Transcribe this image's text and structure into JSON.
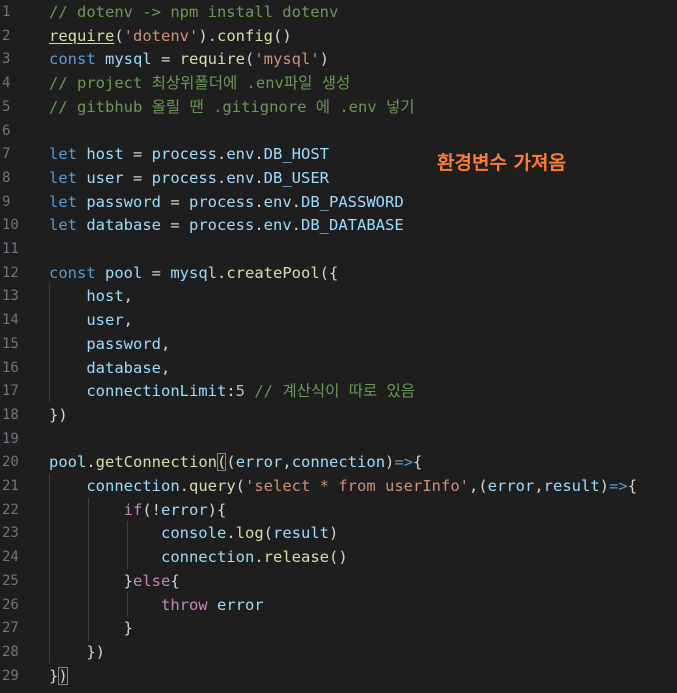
{
  "editor": {
    "lines": [
      {
        "n": "1",
        "tokens": [
          {
            "t": "// dotenv -> npm install dotenv",
            "c": "cm"
          }
        ]
      },
      {
        "n": "2",
        "tokens": [
          {
            "t": "require",
            "c": "fn ul"
          },
          {
            "t": "(",
            "c": "pun"
          },
          {
            "t": "'dotenv'",
            "c": "str"
          },
          {
            "t": ").",
            "c": "pun"
          },
          {
            "t": "config",
            "c": "fn"
          },
          {
            "t": "()",
            "c": "pun"
          }
        ]
      },
      {
        "n": "3",
        "tokens": [
          {
            "t": "const ",
            "c": "kw"
          },
          {
            "t": "mysql",
            "c": "var"
          },
          {
            "t": " = ",
            "c": "pun"
          },
          {
            "t": "require",
            "c": "fn"
          },
          {
            "t": "(",
            "c": "pun"
          },
          {
            "t": "'mysql'",
            "c": "str"
          },
          {
            "t": ")",
            "c": "pun"
          }
        ]
      },
      {
        "n": "4",
        "tokens": [
          {
            "t": "// project 최상위폴더에 .env파일 생성",
            "c": "cm"
          }
        ]
      },
      {
        "n": "5",
        "tokens": [
          {
            "t": "// gitbhub 올릴 땐 .gitignore 에 .env 넣기",
            "c": "cm"
          }
        ]
      },
      {
        "n": "6",
        "tokens": []
      },
      {
        "n": "7",
        "tokens": [
          {
            "t": "let ",
            "c": "kw"
          },
          {
            "t": "host",
            "c": "var"
          },
          {
            "t": " = ",
            "c": "pun"
          },
          {
            "t": "process",
            "c": "var"
          },
          {
            "t": ".",
            "c": "pun"
          },
          {
            "t": "env",
            "c": "var"
          },
          {
            "t": ".",
            "c": "pun"
          },
          {
            "t": "DB_HOST",
            "c": "var"
          }
        ]
      },
      {
        "n": "8",
        "tokens": [
          {
            "t": "let ",
            "c": "kw"
          },
          {
            "t": "user",
            "c": "var"
          },
          {
            "t": " = ",
            "c": "pun"
          },
          {
            "t": "process",
            "c": "var"
          },
          {
            "t": ".",
            "c": "pun"
          },
          {
            "t": "env",
            "c": "var"
          },
          {
            "t": ".",
            "c": "pun"
          },
          {
            "t": "DB_USER",
            "c": "var"
          }
        ]
      },
      {
        "n": "9",
        "tokens": [
          {
            "t": "let ",
            "c": "kw"
          },
          {
            "t": "password",
            "c": "var"
          },
          {
            "t": " = ",
            "c": "pun"
          },
          {
            "t": "process",
            "c": "var"
          },
          {
            "t": ".",
            "c": "pun"
          },
          {
            "t": "env",
            "c": "var"
          },
          {
            "t": ".",
            "c": "pun"
          },
          {
            "t": "DB_PASSWORD",
            "c": "var"
          }
        ]
      },
      {
        "n": "10",
        "tokens": [
          {
            "t": "let ",
            "c": "kw"
          },
          {
            "t": "database",
            "c": "var"
          },
          {
            "t": " = ",
            "c": "pun"
          },
          {
            "t": "process",
            "c": "var"
          },
          {
            "t": ".",
            "c": "pun"
          },
          {
            "t": "env",
            "c": "var"
          },
          {
            "t": ".",
            "c": "pun"
          },
          {
            "t": "DB_DATABASE",
            "c": "var"
          }
        ]
      },
      {
        "n": "11",
        "tokens": []
      },
      {
        "n": "12",
        "tokens": [
          {
            "t": "const ",
            "c": "kw"
          },
          {
            "t": "pool",
            "c": "var"
          },
          {
            "t": " = ",
            "c": "pun"
          },
          {
            "t": "mysql",
            "c": "var"
          },
          {
            "t": ".",
            "c": "pun"
          },
          {
            "t": "createPool",
            "c": "fn"
          },
          {
            "t": "({",
            "c": "pun"
          }
        ]
      },
      {
        "n": "13",
        "tokens": [
          {
            "t": "    ",
            "c": "pun"
          },
          {
            "t": "host",
            "c": "var"
          },
          {
            "t": ",",
            "c": "pun"
          }
        ]
      },
      {
        "n": "14",
        "tokens": [
          {
            "t": "    ",
            "c": "pun"
          },
          {
            "t": "user",
            "c": "var"
          },
          {
            "t": ",",
            "c": "pun"
          }
        ]
      },
      {
        "n": "15",
        "tokens": [
          {
            "t": "    ",
            "c": "pun"
          },
          {
            "t": "password",
            "c": "var"
          },
          {
            "t": ",",
            "c": "pun"
          }
        ]
      },
      {
        "n": "16",
        "tokens": [
          {
            "t": "    ",
            "c": "pun"
          },
          {
            "t": "database",
            "c": "var"
          },
          {
            "t": ",",
            "c": "pun"
          }
        ]
      },
      {
        "n": "17",
        "tokens": [
          {
            "t": "    ",
            "c": "pun"
          },
          {
            "t": "connectionLimit",
            "c": "var"
          },
          {
            "t": ":",
            "c": "pun"
          },
          {
            "t": "5",
            "c": "num"
          },
          {
            "t": " // 계산식이 따로 있음",
            "c": "cm"
          }
        ]
      },
      {
        "n": "18",
        "tokens": [
          {
            "t": "})",
            "c": "pun"
          }
        ]
      },
      {
        "n": "19",
        "tokens": []
      },
      {
        "n": "20",
        "tokens": [
          {
            "t": "pool",
            "c": "var"
          },
          {
            "t": ".",
            "c": "pun"
          },
          {
            "t": "getConnection",
            "c": "fn"
          },
          {
            "t": "(",
            "c": "pun bracket-box"
          },
          {
            "t": "(",
            "c": "pun"
          },
          {
            "t": "error",
            "c": "var"
          },
          {
            "t": ",",
            "c": "pun"
          },
          {
            "t": "connection",
            "c": "var"
          },
          {
            "t": ")",
            "c": "pun"
          },
          {
            "t": "=>",
            "c": "kw"
          },
          {
            "t": "{",
            "c": "pun"
          }
        ]
      },
      {
        "n": "21",
        "tokens": [
          {
            "t": "    ",
            "c": "pun"
          },
          {
            "t": "connection",
            "c": "var"
          },
          {
            "t": ".",
            "c": "pun"
          },
          {
            "t": "query",
            "c": "fn"
          },
          {
            "t": "(",
            "c": "pun"
          },
          {
            "t": "'select * from userInfo'",
            "c": "str"
          },
          {
            "t": ",(",
            "c": "pun"
          },
          {
            "t": "error",
            "c": "var"
          },
          {
            "t": ",",
            "c": "pun"
          },
          {
            "t": "result",
            "c": "var"
          },
          {
            "t": ")",
            "c": "pun"
          },
          {
            "t": "=>",
            "c": "kw"
          },
          {
            "t": "{",
            "c": "pun"
          }
        ]
      },
      {
        "n": "22",
        "tokens": [
          {
            "t": "        ",
            "c": "pun"
          },
          {
            "t": "if",
            "c": "ctrl"
          },
          {
            "t": "(!",
            "c": "pun"
          },
          {
            "t": "error",
            "c": "var"
          },
          {
            "t": "){",
            "c": "pun"
          }
        ]
      },
      {
        "n": "23",
        "tokens": [
          {
            "t": "            ",
            "c": "pun"
          },
          {
            "t": "console",
            "c": "var"
          },
          {
            "t": ".",
            "c": "pun"
          },
          {
            "t": "log",
            "c": "fn"
          },
          {
            "t": "(",
            "c": "pun"
          },
          {
            "t": "result",
            "c": "var"
          },
          {
            "t": ")",
            "c": "pun"
          }
        ]
      },
      {
        "n": "24",
        "tokens": [
          {
            "t": "            ",
            "c": "pun"
          },
          {
            "t": "connection",
            "c": "var"
          },
          {
            "t": ".",
            "c": "pun"
          },
          {
            "t": "release",
            "c": "fn"
          },
          {
            "t": "()",
            "c": "pun"
          }
        ]
      },
      {
        "n": "25",
        "tokens": [
          {
            "t": "        ",
            "c": "pun"
          },
          {
            "t": "}",
            "c": "pun"
          },
          {
            "t": "else",
            "c": "ctrl"
          },
          {
            "t": "{",
            "c": "pun"
          }
        ]
      },
      {
        "n": "26",
        "tokens": [
          {
            "t": "            ",
            "c": "pun"
          },
          {
            "t": "throw ",
            "c": "ctrl"
          },
          {
            "t": "error",
            "c": "var"
          }
        ]
      },
      {
        "n": "27",
        "tokens": [
          {
            "t": "        ",
            "c": "pun"
          },
          {
            "t": "}",
            "c": "pun"
          }
        ]
      },
      {
        "n": "28",
        "tokens": [
          {
            "t": "    ",
            "c": "pun"
          },
          {
            "t": "})",
            "c": "pun"
          }
        ]
      },
      {
        "n": "29",
        "tokens": [
          {
            "t": "}",
            "c": "pun"
          },
          {
            "t": ")",
            "c": "pun bracket-box"
          }
        ]
      }
    ]
  },
  "annotation": {
    "text": "환경변수 가져옴"
  },
  "colors": {
    "background": "#1e1e1e",
    "comment": "#6a9955",
    "keyword": "#569cd6",
    "function": "#dcdcaa",
    "string": "#ce9178",
    "variable": "#9cdcfe",
    "number": "#b5cea8",
    "control": "#c586c0",
    "annotation": "#ff7b33"
  }
}
